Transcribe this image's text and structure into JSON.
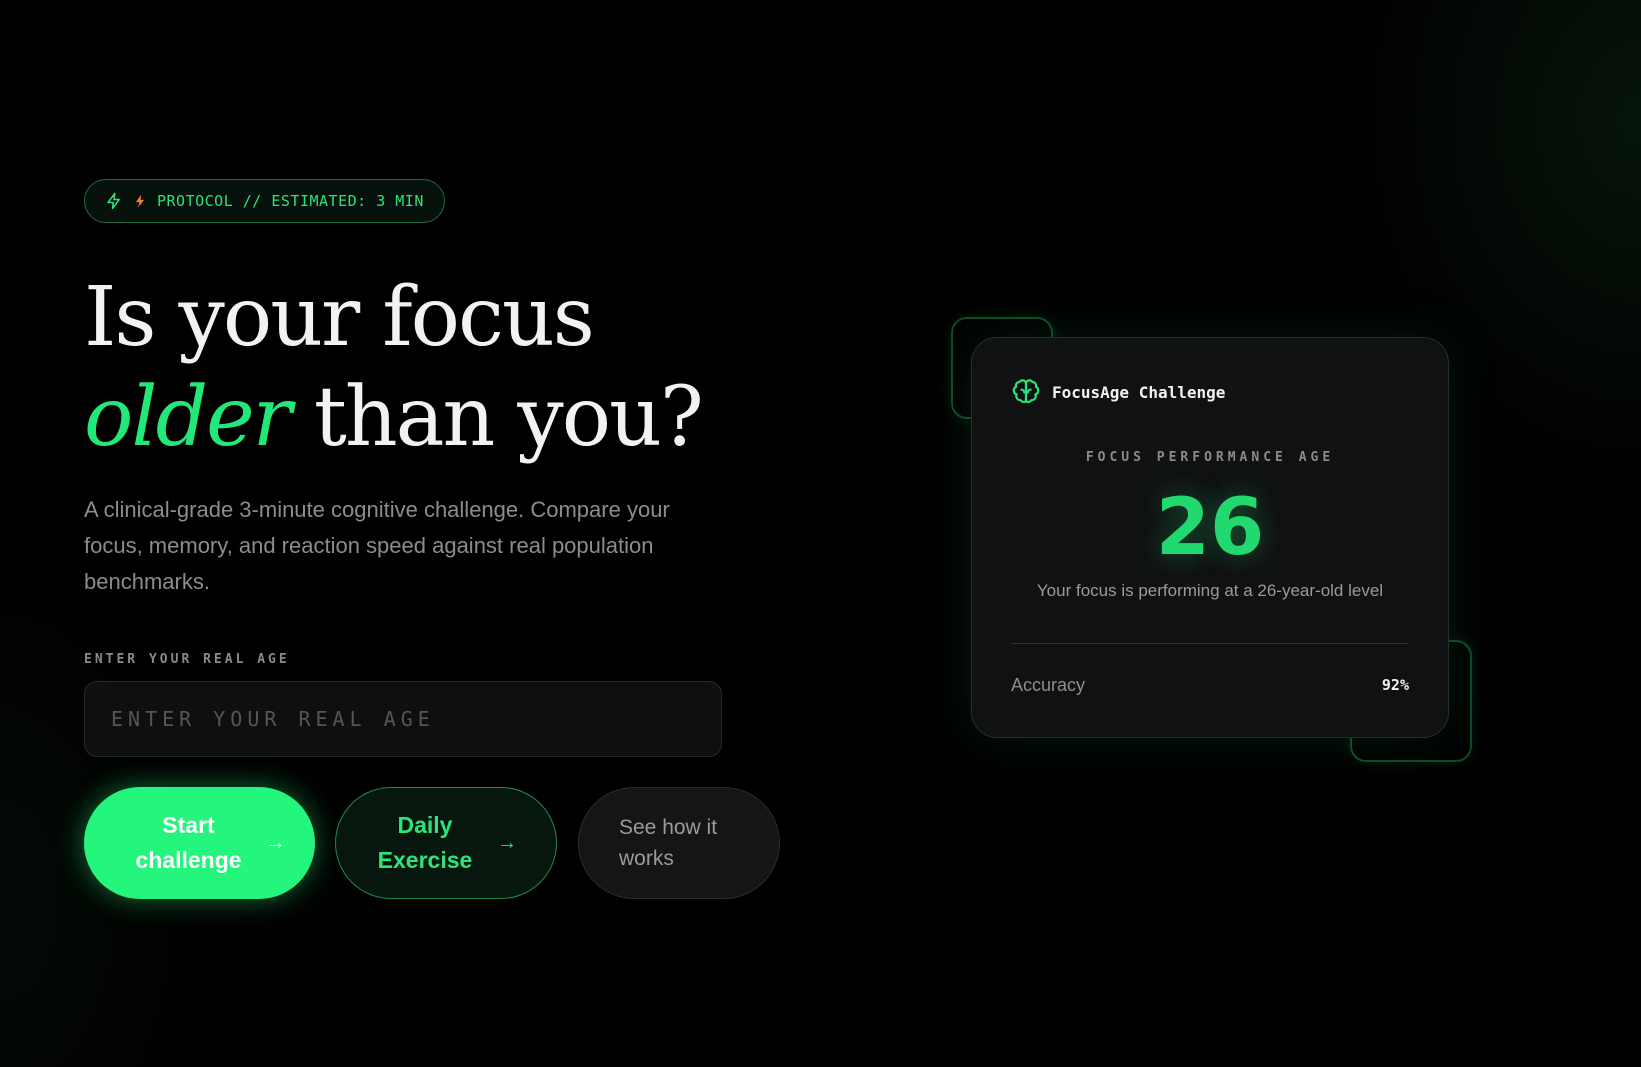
{
  "badge": {
    "text": "PROTOCOL // ESTIMATED: 3 MIN",
    "icons": [
      "zap-outline-icon",
      "zap-filled-icon"
    ],
    "bolt_color": "#ff7a2e"
  },
  "hero": {
    "title_line1": "Is your focus",
    "title_accent": "older",
    "title_line2_rest": " than you?",
    "lede": "A clinical-grade 3-minute cognitive challenge. Compare your focus, memory, and reaction speed against real population benchmarks."
  },
  "age_form": {
    "label": "ENTER YOUR REAL AGE",
    "placeholder": "ENTER YOUR REAL AGE",
    "value": ""
  },
  "actions": {
    "start_label": "Start challenge",
    "daily_label": "Daily Exercise",
    "how_label": "See how it works",
    "arrow": "→"
  },
  "card": {
    "icon": "brain-icon",
    "title": "FocusAge Challenge",
    "kicker": "FOCUS PERFORMANCE AGE",
    "score": "26",
    "caption": "Your focus is performing at a 26-year-old level",
    "stat_label": "Accuracy",
    "stat_value": "92%"
  },
  "colors": {
    "accent": "#22e879",
    "primary_button": "#23f57d",
    "background": "#000000",
    "card": "#101113"
  }
}
